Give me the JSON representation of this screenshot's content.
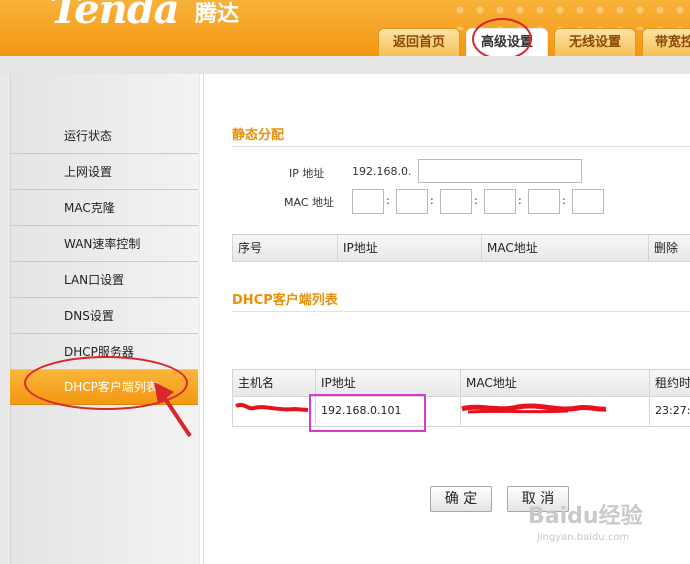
{
  "brand": {
    "logo": "Tenda",
    "logo_cn": "腾达"
  },
  "tabs": [
    {
      "label": "返回首页"
    },
    {
      "label": "高级设置",
      "active": true
    },
    {
      "label": "无线设置"
    },
    {
      "label": "带宽控"
    }
  ],
  "sidebar": {
    "items": [
      {
        "label": "运行状态"
      },
      {
        "label": "上网设置"
      },
      {
        "label": "MAC克隆"
      },
      {
        "label": "WAN速率控制"
      },
      {
        "label": "LAN口设置"
      },
      {
        "label": "DNS设置"
      },
      {
        "label": "DHCP服务器"
      },
      {
        "label": "DHCP客户端列表",
        "active": true
      }
    ]
  },
  "static": {
    "title": "静态分配",
    "ip_label": "IP 地址",
    "ip_prefix": "192.168.0.",
    "mac_label": "MAC 地址",
    "colon": ":",
    "columns": [
      "序号",
      "IP地址",
      "MAC地址",
      "删除"
    ]
  },
  "clients": {
    "title": "DHCP客户端列表",
    "columns": [
      "主机名",
      "IP地址",
      "MAC地址",
      "租约时"
    ],
    "rows": [
      {
        "hostname": "",
        "ip": "192.168.0.101",
        "mac": "",
        "lease": "23:27:"
      }
    ]
  },
  "buttons": {
    "ok": "确 定",
    "cancel": "取 消"
  },
  "watermark": {
    "text": "Baidu经验",
    "url": "jingyan.baidu.com"
  },
  "colors": {
    "accent": "#f39812",
    "annotation_red": "#d9262c",
    "highlight_box": "#d63ad0",
    "title": "#e7900e"
  }
}
